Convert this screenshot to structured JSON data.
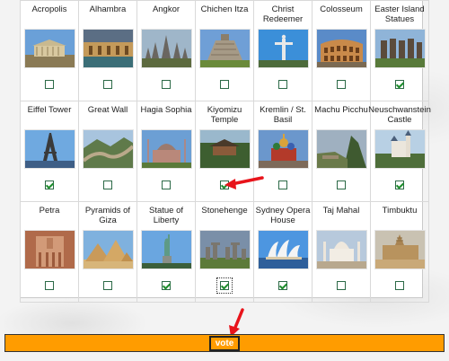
{
  "colors": {
    "accent_orange": "#ff9c00",
    "arrow_red": "#e8141b",
    "check_green": "#1d8d2c"
  },
  "wonders": [
    {
      "label": "Acropolis",
      "icon": "acropolis-photo",
      "checked": false
    },
    {
      "label": "Alhambra",
      "icon": "alhambra-photo",
      "checked": false
    },
    {
      "label": "Angkor",
      "icon": "angkor-photo",
      "checked": false
    },
    {
      "label": "Chichen Itza",
      "icon": "chichen-itza-photo",
      "checked": false
    },
    {
      "label": "Christ Redeemer",
      "icon": "christ-redeemer-photo",
      "checked": false
    },
    {
      "label": "Colosseum",
      "icon": "colosseum-photo",
      "checked": false
    },
    {
      "label": "Easter Island Statues",
      "icon": "easter-island-photo",
      "checked": true
    },
    {
      "label": "Eiffel Tower",
      "icon": "eiffel-tower-photo",
      "checked": true
    },
    {
      "label": "Great Wall",
      "icon": "great-wall-photo",
      "checked": false
    },
    {
      "label": "Hagia Sophia",
      "icon": "hagia-sophia-photo",
      "checked": false
    },
    {
      "label": "Kiyomizu Temple",
      "icon": "kiyomizu-temple-photo",
      "checked": true
    },
    {
      "label": "Kremlin / St. Basil",
      "icon": "kremlin-photo",
      "checked": false
    },
    {
      "label": "Machu Picchu",
      "icon": "machu-picchu-photo",
      "checked": false
    },
    {
      "label": "Neuschwanstein Castle",
      "icon": "neuschwanstein-photo",
      "checked": true
    },
    {
      "label": "Petra",
      "icon": "petra-photo",
      "checked": false
    },
    {
      "label": "Pyramids of Giza",
      "icon": "pyramids-photo",
      "checked": false
    },
    {
      "label": "Statue of Liberty",
      "icon": "statue-of-liberty-photo",
      "checked": true
    },
    {
      "label": "Stonehenge",
      "icon": "stonehenge-photo",
      "checked": true
    },
    {
      "label": "Sydney Opera House",
      "icon": "sydney-opera-photo",
      "checked": true
    },
    {
      "label": "Taj Mahal",
      "icon": "taj-mahal-photo",
      "checked": false
    },
    {
      "label": "Timbuktu",
      "icon": "timbuktu-photo",
      "checked": false
    }
  ],
  "vote_label": "vote"
}
